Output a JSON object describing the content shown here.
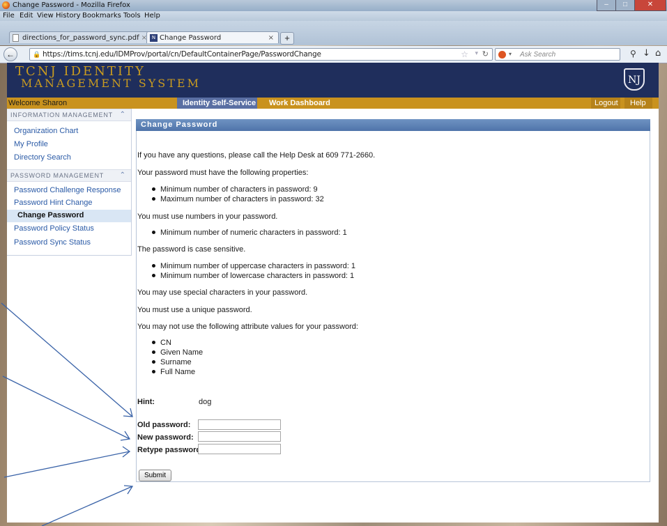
{
  "browser": {
    "window_title": "Change Password - Mozilla Firefox",
    "menu": [
      "File",
      "Edit",
      "View",
      "History",
      "Bookmarks",
      "Tools",
      "Help"
    ],
    "tabs": [
      {
        "label": "directions_for_password_sync.pdf",
        "active": false
      },
      {
        "label": "Change Password",
        "active": true
      }
    ],
    "url": "https://tims.tcnj.edu/IDMProv/portal/cn/DefaultContainerPage/PasswordChange",
    "search_placeholder": "Ask Search"
  },
  "header": {
    "title_line1": "TCNJ IDENTITY",
    "title_line2": "MANAGEMENT SYSTEM",
    "logo_text": "NJ",
    "brand_color": "#1f2e5c",
    "accent_color": "#c9921e"
  },
  "topnav": {
    "welcome": "Welcome Sharon",
    "tabs": [
      "Identity Self-Service",
      "Work Dashboard"
    ],
    "logout": "Logout",
    "help": "Help"
  },
  "sidebar": {
    "sections": [
      {
        "title": "INFORMATION MANAGEMENT",
        "items": [
          "Organization Chart",
          "My Profile",
          "Directory Search"
        ]
      },
      {
        "title": "PASSWORD MANAGEMENT",
        "items": [
          "Password Challenge Response",
          "Password Hint Change",
          "Change Password",
          "Password Policy Status",
          "Password Sync Status"
        ],
        "selected": "Change Password"
      }
    ]
  },
  "content": {
    "panel_title": "Change Password",
    "help_line": "If you have any questions, please call the Help Desk at 609 771-2660.",
    "props_heading": "Your password must have the following properties:",
    "length_rules": [
      "Minimum number of characters in password: 9",
      "Maximum number of characters in password: 32"
    ],
    "numbers_heading": "You must use numbers in your password.",
    "numeric_rules": [
      "Minimum number of numeric characters in password: 1"
    ],
    "case_heading": "The password is case sensitive.",
    "case_rules": [
      "Minimum number of uppercase characters in password: 1",
      "Minimum number of lowercase characters in password: 1"
    ],
    "special_line": "You may use special characters in your password.",
    "unique_line": "You must use a unique password.",
    "attr_heading": "You may not use the following attribute values for your password:",
    "attributes": [
      "CN",
      "Given Name",
      "Surname",
      "Full Name"
    ],
    "hint_label": "Hint:",
    "hint_value": "dog",
    "old_label": "Old password:",
    "new_label": "New password:",
    "retype_label": "Retype password:",
    "old_value": "",
    "new_value": "",
    "retype_value": "",
    "submit_label": "Submit"
  }
}
